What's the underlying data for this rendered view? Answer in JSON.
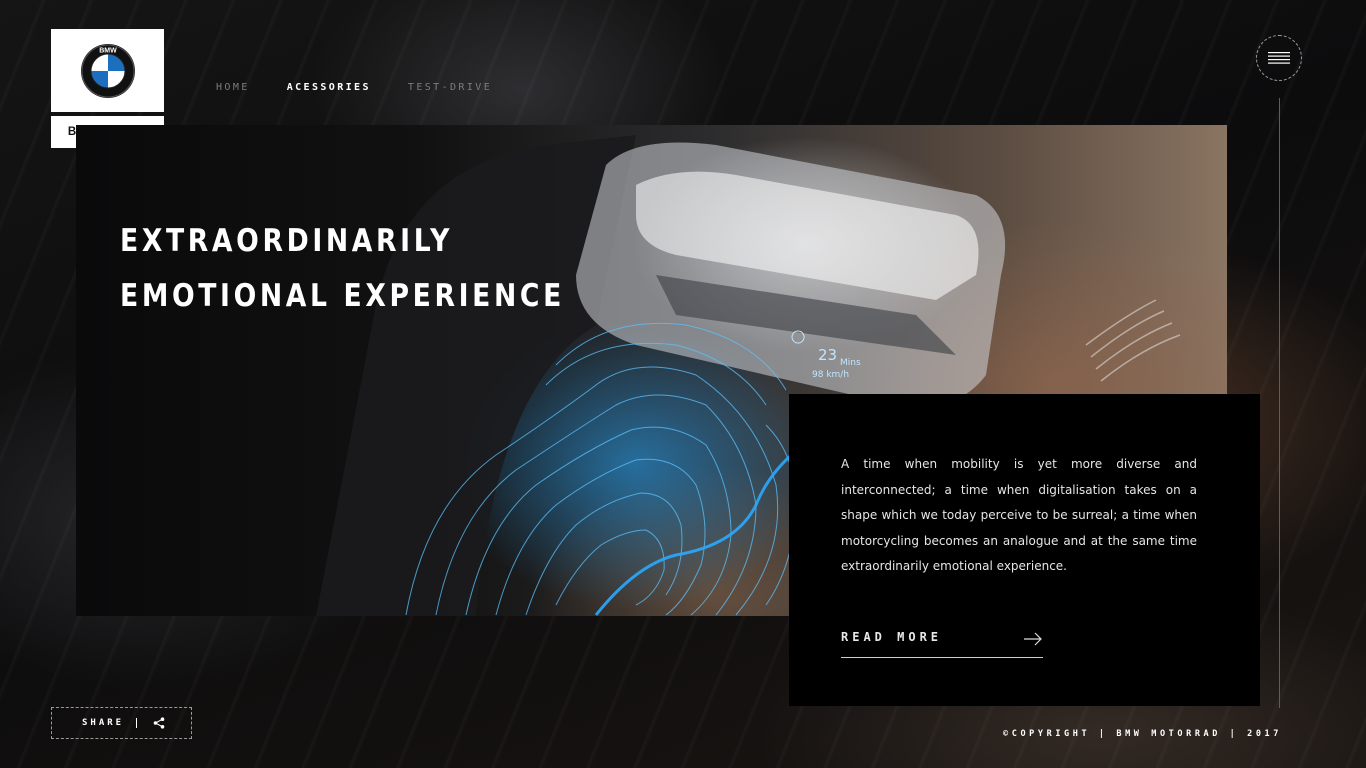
{
  "brand": {
    "name": "BMW Motorrad",
    "logo_text": "BMW"
  },
  "nav": {
    "items": [
      {
        "label": "HOME",
        "active": false
      },
      {
        "label": "ACESSORIES",
        "active": true
      },
      {
        "label": "TEST-DRIVE",
        "active": false
      }
    ]
  },
  "menu": {
    "icon": "hamburger-icon"
  },
  "hero": {
    "headline_line1": "EXTRAORDINARILY",
    "headline_line2": "EMOTIONAL EXPERIENCE",
    "overlay_time": "23",
    "overlay_time_unit": "Mins",
    "overlay_speed": "98 km/h"
  },
  "card": {
    "body": "A time when mobility is yet more diverse and interconnected; a time when digitalisation takes on a shape which we today perceive to be surreal; a time when motorcycling becomes an analogue and at the same time extraordinarily emotional experience.",
    "read_more_label": "READ MORE",
    "arrow_icon": "arrow-right-icon"
  },
  "share": {
    "label": "SHARE",
    "icon": "share-icon"
  },
  "footer": {
    "copyright": "©COPYRIGHT | BMW MOTORRAD | 2017"
  },
  "colors": {
    "background": "#0b0b0c",
    "card": "#000000",
    "accent_blue": "#1fa6ff",
    "nav_inactive": "#7c7c80"
  }
}
